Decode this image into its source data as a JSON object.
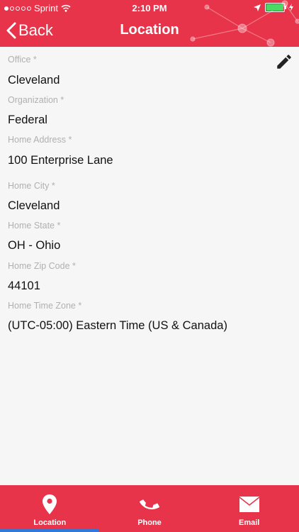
{
  "status_bar": {
    "carrier": "Sprint",
    "time": "2:10 PM"
  },
  "nav": {
    "back_label": "Back",
    "title": "Location"
  },
  "fields": [
    {
      "label": "Office *",
      "value": "Cleveland"
    },
    {
      "label": "Organization *",
      "value": "Federal"
    },
    {
      "label": "Home Address *",
      "value": "100 Enterprise Lane"
    },
    {
      "label": "Home City *",
      "value": "Cleveland"
    },
    {
      "label": "Home State *",
      "value": "OH - Ohio"
    },
    {
      "label": "Home Zip Code *",
      "value": "44101"
    },
    {
      "label": "Home Time Zone *",
      "value": "(UTC-05:00) Eastern Time (US & Canada)"
    }
  ],
  "tabs": [
    {
      "label": "Location",
      "icon": "location-pin-icon",
      "selected": true
    },
    {
      "label": "Phone",
      "icon": "phone-icon",
      "selected": false
    },
    {
      "label": "Email",
      "icon": "envelope-icon",
      "selected": false
    }
  ],
  "colors": {
    "brand": "#e8344a",
    "background": "#f6f6f6",
    "label": "#b0b0b0",
    "value": "#111111",
    "tab_indicator": "#2f7ad6",
    "battery": "#4cd964"
  }
}
